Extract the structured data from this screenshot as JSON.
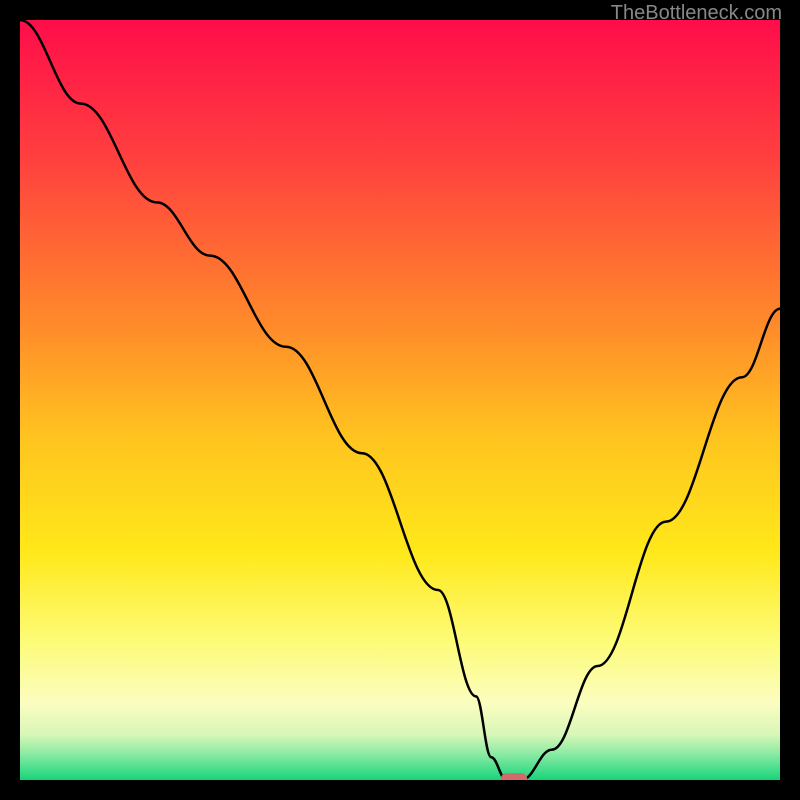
{
  "watermark": "TheBottleneck.com",
  "chart_data": {
    "type": "line",
    "title": "",
    "xlabel": "",
    "ylabel": "",
    "xlim": [
      0,
      100
    ],
    "ylim": [
      0,
      100
    ],
    "gradient_stops": [
      {
        "offset": 0,
        "color": "#ff0d4a"
      },
      {
        "offset": 18,
        "color": "#ff3f3f"
      },
      {
        "offset": 40,
        "color": "#ff8a2a"
      },
      {
        "offset": 55,
        "color": "#ffc41f"
      },
      {
        "offset": 70,
        "color": "#ffe81a"
      },
      {
        "offset": 82,
        "color": "#fdfc7a"
      },
      {
        "offset": 90,
        "color": "#fbfdc0"
      },
      {
        "offset": 94,
        "color": "#d8f7b8"
      },
      {
        "offset": 97,
        "color": "#7de89f"
      },
      {
        "offset": 100,
        "color": "#18d47a"
      }
    ],
    "series": [
      {
        "name": "bottleneck-curve",
        "x": [
          0,
          8,
          18,
          25,
          35,
          45,
          55,
          60,
          62,
          64,
          66,
          70,
          76,
          85,
          95,
          100
        ],
        "y": [
          100,
          89,
          76,
          69,
          57,
          43,
          25,
          11,
          3,
          0,
          0,
          4,
          15,
          34,
          53,
          62
        ]
      }
    ],
    "marker": {
      "x": 65,
      "y": 0,
      "color": "#d16a6a",
      "width": 3.5,
      "height": 1.8
    }
  }
}
